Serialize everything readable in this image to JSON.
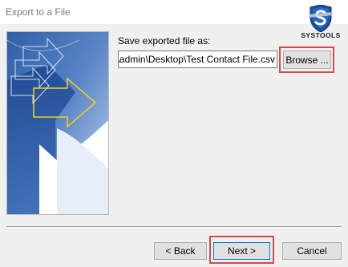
{
  "window": {
    "title": "Export to a File"
  },
  "brand": {
    "logo_text": "SYSTOOLS",
    "accent_color": "#1b4fa0",
    "highlight_color": "#d34b4b"
  },
  "form": {
    "save_label": "Save exported file as:",
    "file_path": ":\\admin\\Desktop\\Test Contact File.csv",
    "browse_label": "Browse ..."
  },
  "footer": {
    "back_label": "< Back",
    "next_label": "Next >",
    "cancel_label": "Cancel"
  }
}
